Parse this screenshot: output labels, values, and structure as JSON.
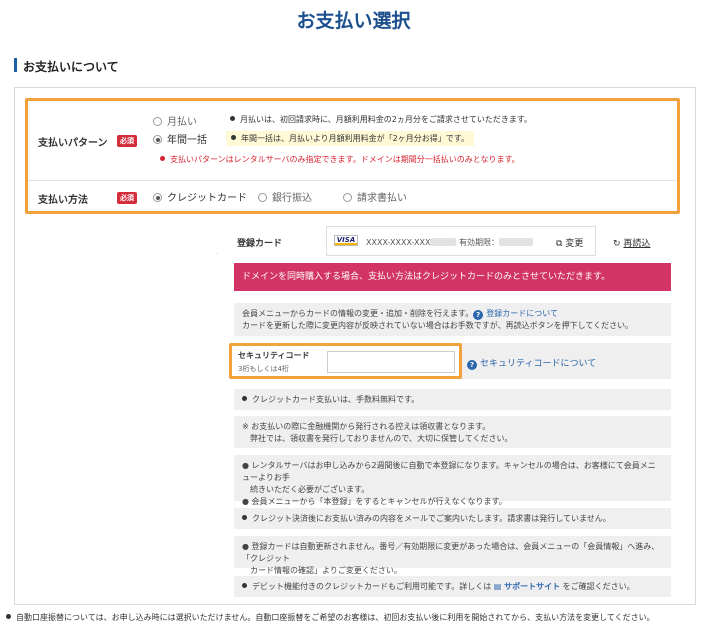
{
  "page_title": "お支払い選択",
  "section_title": "お支払いについて",
  "payment_pattern": {
    "label": "支払いパターン",
    "required": "必須",
    "options": [
      "月払い",
      "年間一括"
    ],
    "selected": "年間一括",
    "monthly_note": "月払いは、初回請求時に、月額利用料金の2ヵ月分をご請求させていただきます。",
    "annual_note": "年間一括は、月払いより月額利用料金が「2ヶ月分お得」です。",
    "warning": "支払いパターンはレンタルサーバのみ指定できます。ドメインは期間分一括払いのみとなります。"
  },
  "payment_method": {
    "label": "支払い方法",
    "required": "必須",
    "options": [
      "クレジットカード",
      "銀行振込",
      "請求書払い"
    ],
    "selected": "クレジットカード"
  },
  "registered_card": {
    "label": "登録カード",
    "brand": "VISA",
    "number": "XXXX-XXXX-XXX",
    "expiry_label": "有効期限：",
    "change_label": "変更",
    "reload_label": "再読込"
  },
  "domain_notice": "ドメインを同時購入する場合、支払い方法はクレジットカードのみとさせていただきます。",
  "card_info": {
    "line1": "会員メニューからカードの情報の変更・追加・削除を行えます。",
    "link": "登録カードについて",
    "line2": "カードを更新した際に変更内容が反映されていない場合はお手数ですが、再読込ボタンを押下してください。"
  },
  "security_code": {
    "label": "セキュリティコード",
    "hint": "3桁もしくは4桁",
    "value": "",
    "help_link": "セキュリティコードについて"
  },
  "notes": [
    [
      "クレジットカード支払いは、手数料無料です。"
    ],
    [
      "※ お支払いの際に金融機関から発行される控えは領収書となります。",
      "　弊社では、領収書を発行しておりませんので、大切に保管してください。"
    ],
    [
      "● レンタルサーバはお申し込みから2週間後に自動で本登録になります。キャンセルの場合は、お客様にて会員メニューよりお手",
      "　続きいただく必要がございます。",
      "● 会員メニューから「本登録」をするとキャンセルが行えなくなります。"
    ],
    [
      "クレジット決済後にお支払い済みの内容をメールでご案内いたします。請求書は発行していません。"
    ],
    [
      "● 登録カードは自動更新されません。番号／有効期限に変更があった場合は、会員メニューの「会員情報」へ進み、「クレジット",
      "　カード情報の確認」よりご変更ください。"
    ]
  ],
  "debit_note": {
    "text1": "デビット機能付きのクレジットカードもご利用可能です。詳しくは",
    "link": "サポートサイト",
    "text2": "をご確認ください。"
  },
  "bottom_note": "自動口座振替については、お申し込み時には選択いただけません。自動口座振替をご希望のお客様は、初回お支払い後に利用を開始されてから、支払い方法を変更してください。",
  "colors": {
    "title": "#1c4f8e",
    "highlight_border": "#f2a23b",
    "required_badge": "#d42d3c",
    "notice_bg": "#d23565",
    "link": "#2a65ad"
  }
}
